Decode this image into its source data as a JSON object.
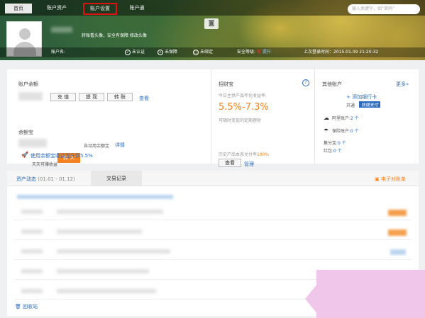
{
  "nav": {
    "home": "首页",
    "assets": "账户资产",
    "settings": "账户设置",
    "tong": "账户通",
    "search_placeholder": "输入关键字，如“密码”"
  },
  "profile": {
    "slogan": "转账看头像，安全有保障 修改头像",
    "account_label": "账户名:",
    "verify": "未认证",
    "protect": "未保障",
    "bind": "未绑定",
    "security_label": "安全等级:",
    "security_level": "低",
    "upgrade": "提升",
    "last_login": "上次登录时间：2015.01.09 21:20:32"
  },
  "balance": {
    "title": "账户余额",
    "recharge": "充 值",
    "withdraw": "提 现",
    "transfer": "转 账",
    "view": "查看"
  },
  "yuebao": {
    "title": "余额宝",
    "transfer_in": "转 入",
    "auto": "自动用余额宝",
    "detail": "详情",
    "tip": "使用余额宝收益提升到5.5%",
    "daily": "天天可赚收益"
  },
  "zhaocai": {
    "title": "招财宝",
    "desc": "今日主供产品年化收益率:",
    "rate": "5.5%-7.3%",
    "note": "可随时变现的定期理财",
    "view": "查看",
    "manage": "管理",
    "history": "历史产品本息兑付率",
    "history_rate": "100%"
  },
  "other": {
    "title": "其他账户",
    "more": "更多»",
    "add_card": "+ 添加银行卡",
    "open": "开通",
    "quick": "快捷支付",
    "alipay": "阿里账户:",
    "alipay_count": "2 个",
    "insurance": "保险账户:",
    "insurance_count": "0 个",
    "jifen": "集分宝:",
    "jifen_val": "0 个",
    "hongbao": "红包:",
    "hongbao_val": "0 个"
  },
  "tabs": {
    "trend": "资产动态",
    "period": "(01.01 - 01.12)",
    "trade": "交易记录",
    "ebill": "电子对账单"
  },
  "footer": {
    "recycle": "回收站"
  },
  "colors": {
    "accent": "#f5821f",
    "link": "#2a6bc0",
    "highlight": "#d11111"
  }
}
